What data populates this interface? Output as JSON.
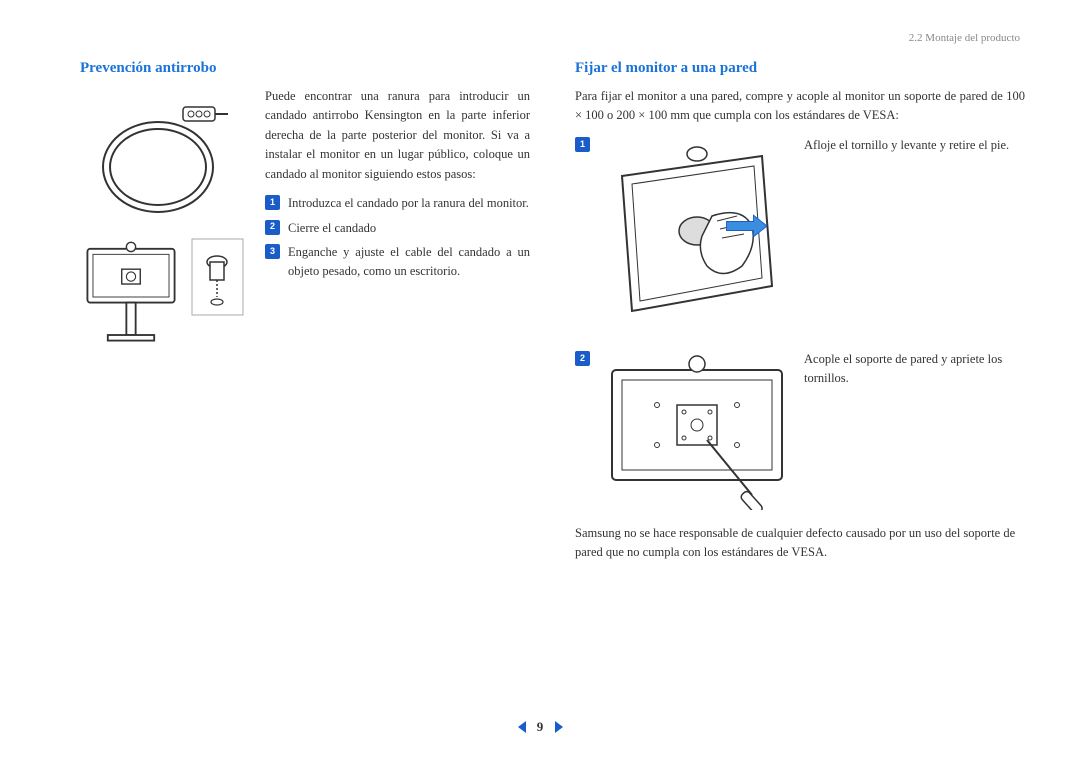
{
  "header": {
    "breadcrumb": "2.2 Montaje del producto"
  },
  "left": {
    "heading": "Prevención antirrobo",
    "intro": "Puede encontrar una ranura para introducir un candado antirrobo Kensington en la parte inferior derecha de la parte posterior del monitor. Si va a instalar el monitor en un lugar público, coloque un candado al monitor siguiendo estos pasos:",
    "steps": [
      "Introduzca el candado por la ranura del monitor.",
      "Cierre el candado",
      "Enganche y ajuste el cable del candado a un objeto pesado, como un escritorio."
    ]
  },
  "right": {
    "heading": "Fijar el monitor a una pared",
    "intro": "Para fijar el monitor a una pared, compre y acople al monitor un soporte de pared de 100 × 100 o 200 × 100 mm que cumpla con los estándares de VESA:",
    "steps": [
      "Afloje el tornillo y levante y retire el pie.",
      "Acople el soporte de pared y apriete los tornillos."
    ],
    "disclaimer": "Samsung no se hace responsable de cualquier defecto causado por un uso del soporte de pared que no cumpla con los estándares de VESA."
  },
  "footer": {
    "page": "9"
  }
}
